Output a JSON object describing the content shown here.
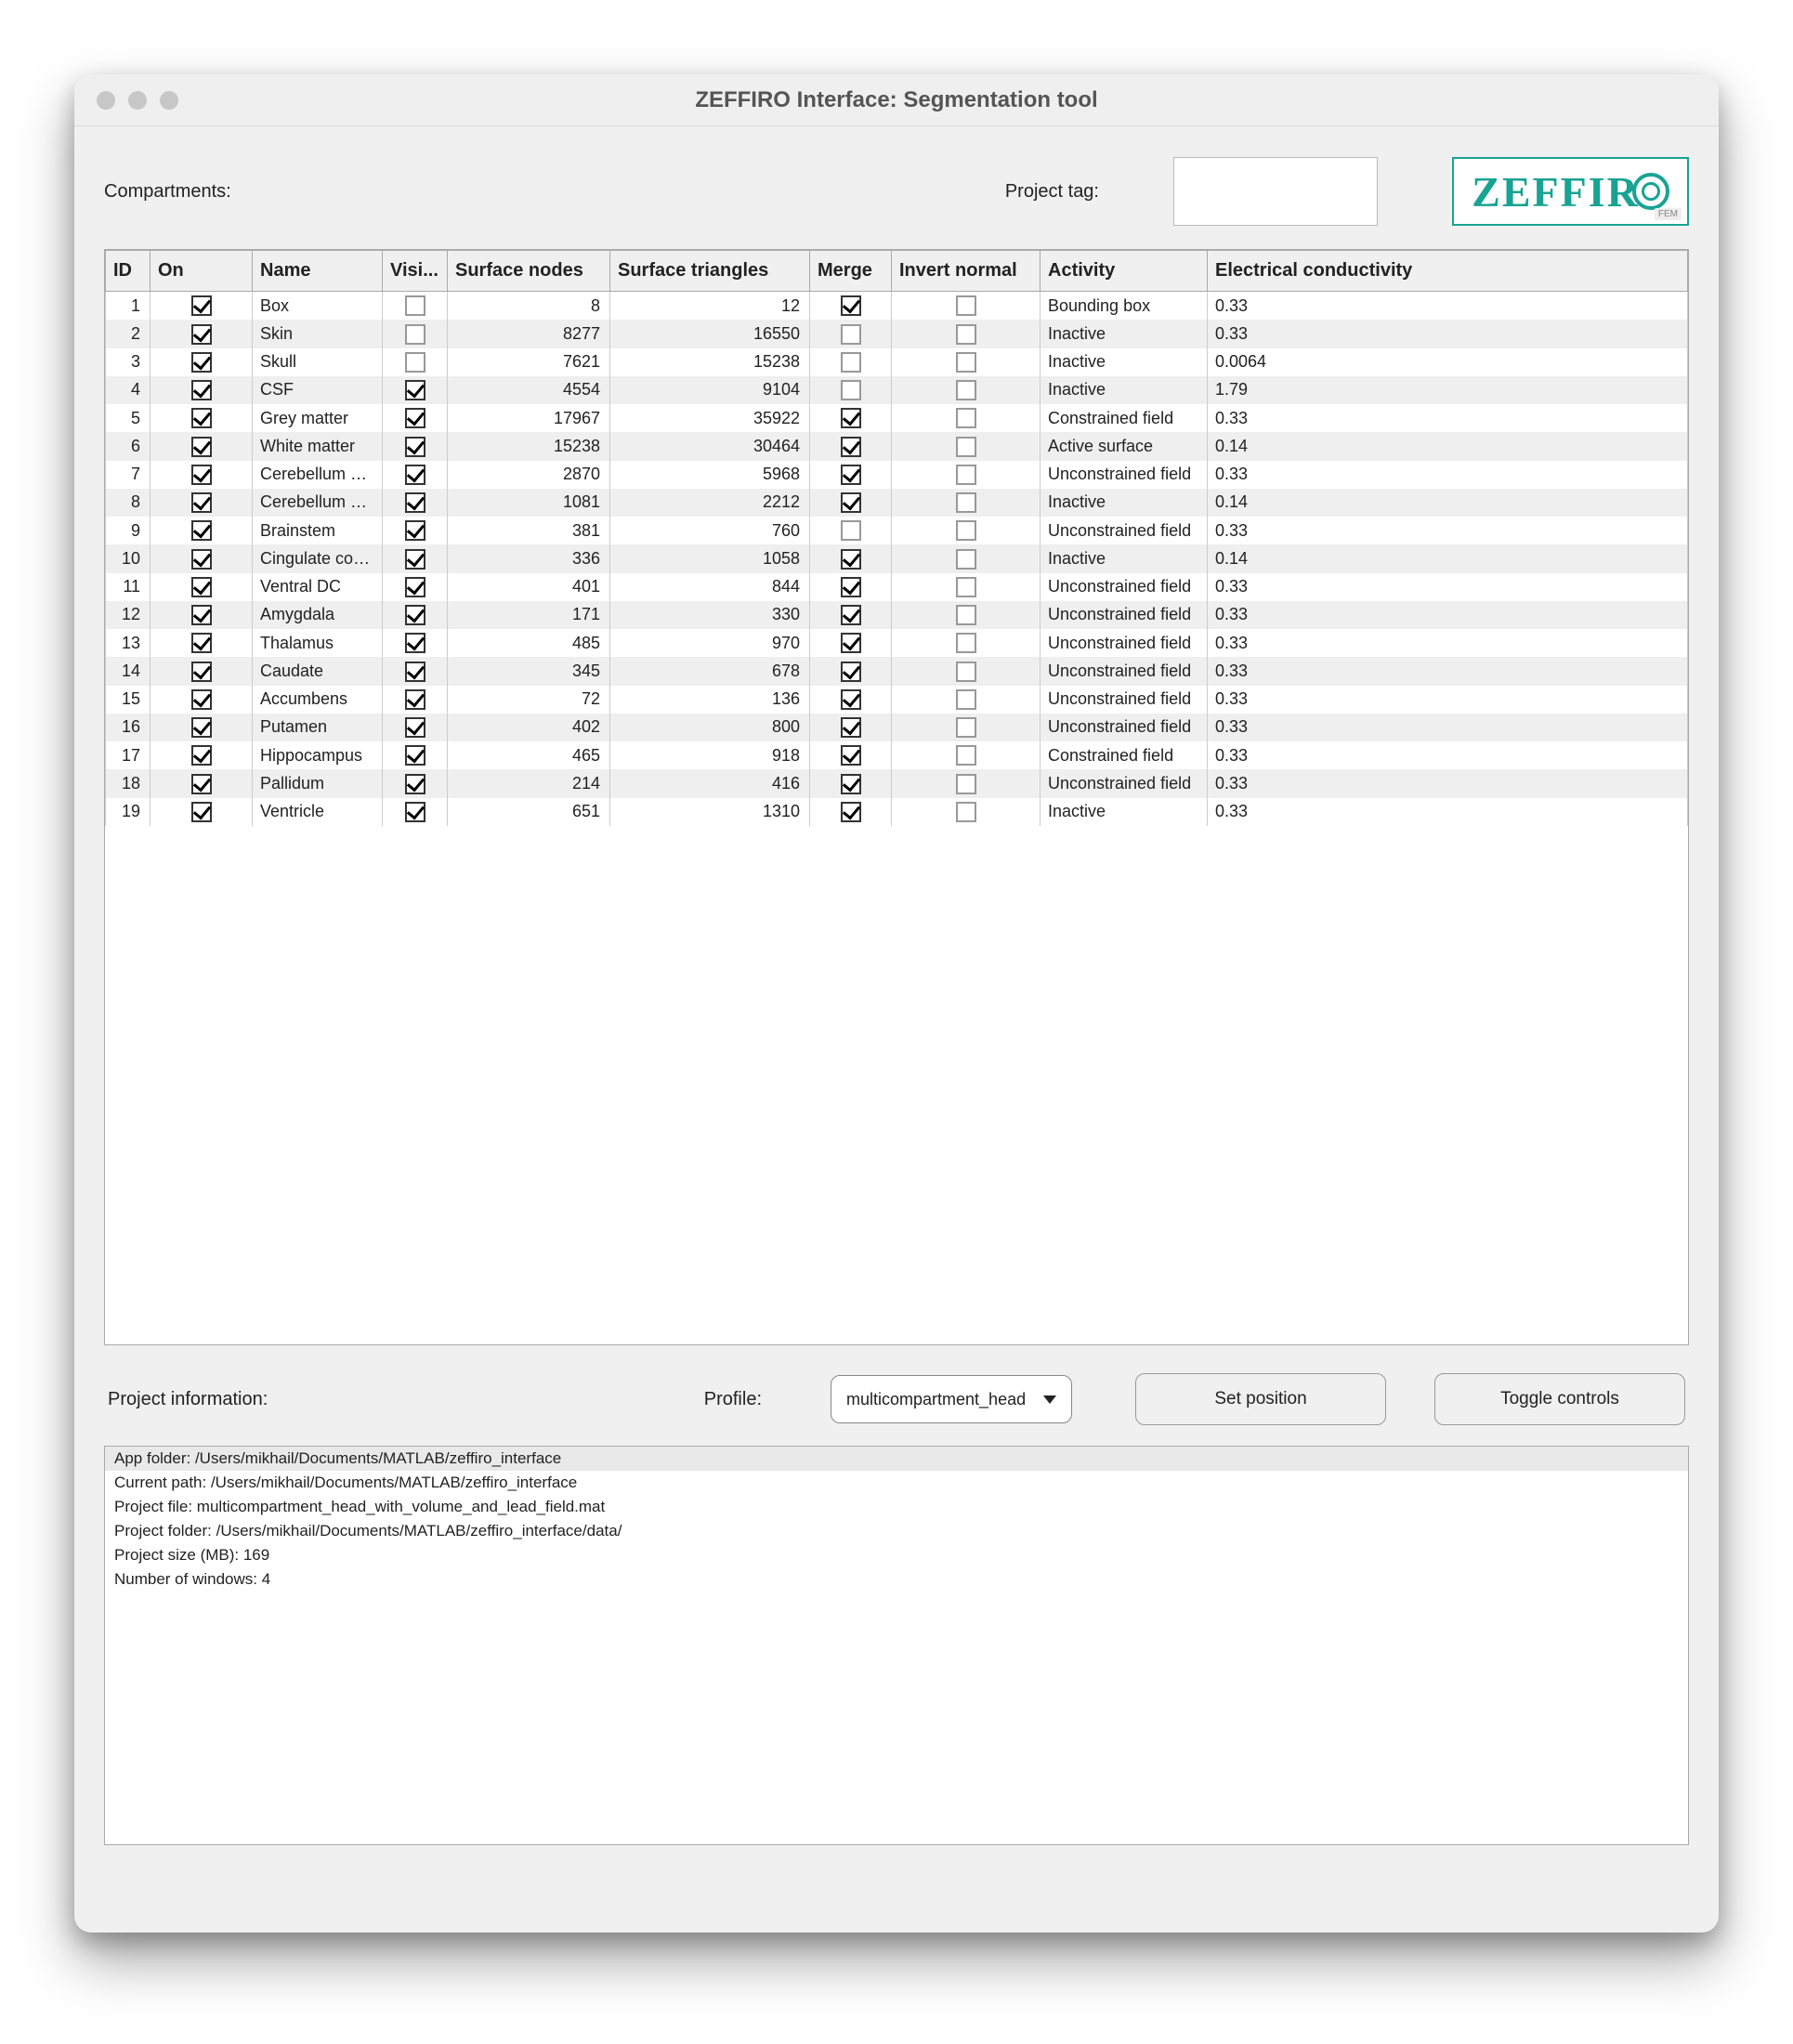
{
  "window": {
    "title": "ZEFFIRO Interface: Segmentation tool"
  },
  "labels": {
    "compartments": "Compartments:",
    "project_tag": "Project tag:",
    "project_info": "Project information:",
    "profile": "Profile:"
  },
  "logo": {
    "text": "ZEFFIR",
    "badge": "FEM"
  },
  "project_tag_value": "",
  "table": {
    "headers": {
      "id": "ID",
      "on": "On",
      "name": "Name",
      "vis": "Visi...",
      "surface_nodes": "Surface nodes",
      "surface_triangles": "Surface triangles",
      "merge": "Merge",
      "invert_normal": "Invert normal",
      "activity": "Activity",
      "conductivity": "Electrical conductivity"
    },
    "rows": [
      {
        "id": 1,
        "on": true,
        "name": "Box",
        "vis": false,
        "surface_nodes": 8,
        "surface_triangles": 12,
        "merge": true,
        "invert_normal": false,
        "activity": "Bounding box",
        "conductivity": "0.33"
      },
      {
        "id": 2,
        "on": true,
        "name": "Skin",
        "vis": false,
        "surface_nodes": 8277,
        "surface_triangles": 16550,
        "merge": false,
        "invert_normal": false,
        "activity": "Inactive",
        "conductivity": "0.33"
      },
      {
        "id": 3,
        "on": true,
        "name": "Skull",
        "vis": false,
        "surface_nodes": 7621,
        "surface_triangles": 15238,
        "merge": false,
        "invert_normal": false,
        "activity": "Inactive",
        "conductivity": "0.0064"
      },
      {
        "id": 4,
        "on": true,
        "name": "CSF",
        "vis": true,
        "surface_nodes": 4554,
        "surface_triangles": 9104,
        "merge": false,
        "invert_normal": false,
        "activity": "Inactive",
        "conductivity": "1.79"
      },
      {
        "id": 5,
        "on": true,
        "name": "Grey matter",
        "vis": true,
        "surface_nodes": 17967,
        "surface_triangles": 35922,
        "merge": true,
        "invert_normal": false,
        "activity": "Constrained field",
        "conductivity": "0.33"
      },
      {
        "id": 6,
        "on": true,
        "name": "White matter",
        "vis": true,
        "surface_nodes": 15238,
        "surface_triangles": 30464,
        "merge": true,
        "invert_normal": false,
        "activity": "Active surface",
        "conductivity": "0.14"
      },
      {
        "id": 7,
        "on": true,
        "name": "Cerebellum cor...",
        "vis": true,
        "surface_nodes": 2870,
        "surface_triangles": 5968,
        "merge": true,
        "invert_normal": false,
        "activity": "Unconstrained field",
        "conductivity": "0.33"
      },
      {
        "id": 8,
        "on": true,
        "name": "Cerebellum WM",
        "vis": true,
        "surface_nodes": 1081,
        "surface_triangles": 2212,
        "merge": true,
        "invert_normal": false,
        "activity": "Inactive",
        "conductivity": "0.14"
      },
      {
        "id": 9,
        "on": true,
        "name": "Brainstem",
        "vis": true,
        "surface_nodes": 381,
        "surface_triangles": 760,
        "merge": false,
        "invert_normal": false,
        "activity": "Unconstrained field",
        "conductivity": "0.33"
      },
      {
        "id": 10,
        "on": true,
        "name": "Cingulate cortex",
        "vis": true,
        "surface_nodes": 336,
        "surface_triangles": 1058,
        "merge": true,
        "invert_normal": false,
        "activity": "Inactive",
        "conductivity": "0.14"
      },
      {
        "id": 11,
        "on": true,
        "name": "Ventral DC",
        "vis": true,
        "surface_nodes": 401,
        "surface_triangles": 844,
        "merge": true,
        "invert_normal": false,
        "activity": "Unconstrained field",
        "conductivity": "0.33"
      },
      {
        "id": 12,
        "on": true,
        "name": "Amygdala",
        "vis": true,
        "surface_nodes": 171,
        "surface_triangles": 330,
        "merge": true,
        "invert_normal": false,
        "activity": "Unconstrained field",
        "conductivity": "0.33"
      },
      {
        "id": 13,
        "on": true,
        "name": "Thalamus",
        "vis": true,
        "surface_nodes": 485,
        "surface_triangles": 970,
        "merge": true,
        "invert_normal": false,
        "activity": "Unconstrained field",
        "conductivity": "0.33"
      },
      {
        "id": 14,
        "on": true,
        "name": "Caudate",
        "vis": true,
        "surface_nodes": 345,
        "surface_triangles": 678,
        "merge": true,
        "invert_normal": false,
        "activity": "Unconstrained field",
        "conductivity": "0.33"
      },
      {
        "id": 15,
        "on": true,
        "name": "Accumbens",
        "vis": true,
        "surface_nodes": 72,
        "surface_triangles": 136,
        "merge": true,
        "invert_normal": false,
        "activity": "Unconstrained field",
        "conductivity": "0.33"
      },
      {
        "id": 16,
        "on": true,
        "name": "Putamen",
        "vis": true,
        "surface_nodes": 402,
        "surface_triangles": 800,
        "merge": true,
        "invert_normal": false,
        "activity": "Unconstrained field",
        "conductivity": "0.33"
      },
      {
        "id": 17,
        "on": true,
        "name": "Hippocampus",
        "vis": true,
        "surface_nodes": 465,
        "surface_triangles": 918,
        "merge": true,
        "invert_normal": false,
        "activity": "Constrained field",
        "conductivity": "0.33"
      },
      {
        "id": 18,
        "on": true,
        "name": "Pallidum",
        "vis": true,
        "surface_nodes": 214,
        "surface_triangles": 416,
        "merge": true,
        "invert_normal": false,
        "activity": "Unconstrained field",
        "conductivity": "0.33"
      },
      {
        "id": 19,
        "on": true,
        "name": "Ventricle",
        "vis": true,
        "surface_nodes": 651,
        "surface_triangles": 1310,
        "merge": true,
        "invert_normal": false,
        "activity": "Inactive",
        "conductivity": "0.33"
      }
    ]
  },
  "controls": {
    "profile_value": "multicompartment_head",
    "set_position": "Set position",
    "toggle_controls": "Toggle controls"
  },
  "project_info": {
    "lines": [
      "App folder: /Users/mikhail/Documents/MATLAB/zeffiro_interface",
      "Current path: /Users/mikhail/Documents/MATLAB/zeffiro_interface",
      "Project file: multicompartment_head_with_volume_and_lead_field.mat",
      "Project folder: /Users/mikhail/Documents/MATLAB/zeffiro_interface/data/",
      "Project size (MB): 169",
      "Number of windows: 4"
    ]
  }
}
